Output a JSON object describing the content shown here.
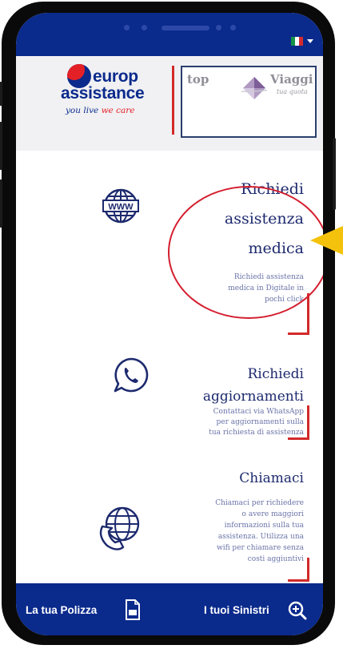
{
  "colors": {
    "brand_blue": "#0a2a8c",
    "accent_red": "#d22a2a",
    "highlight_circle": "#d41f2f",
    "arrow_yellow": "#f4c20d"
  },
  "header": {
    "logo_main_line1": "europ",
    "logo_main_line2": "assistance",
    "logo_tagline_a": "you live",
    "logo_tagline_b": "we care",
    "partner_left": "top",
    "partner_right": "Viaggi",
    "partner_sub": "tua quota"
  },
  "services": [
    {
      "title_lines": [
        "Richiedi",
        "assistenza",
        "medica"
      ],
      "description_lines": [
        "Richiedi assistenza",
        "medica in Digitale in",
        "pochi click"
      ],
      "icon": "www-globe-icon"
    },
    {
      "title_lines": [
        "Richiedi",
        "aggiornamenti"
      ],
      "description_lines": [
        "Contattaci via WhatsApp",
        "per aggiornamenti sulla",
        "tua richiesta di assistenza"
      ],
      "icon": "whatsapp-icon"
    },
    {
      "title_lines": [
        "Chiamaci"
      ],
      "description_lines": [
        "Chiamaci per richiedere",
        "o avere maggiori",
        "informazioni sulla tua",
        "assistenza. Utilizza una",
        "wifi per chiamare senza",
        "costi aggiuntivi"
      ],
      "icon": "globe-phone-icon"
    }
  ],
  "bottom_nav": {
    "policy_label": "La tua Polizza",
    "claims_label": "I tuoi Sinistri"
  },
  "icons": {
    "language_flag": "italy-flag-icon",
    "policy": "document-icon",
    "claims": "magnifier-plus-icon"
  }
}
